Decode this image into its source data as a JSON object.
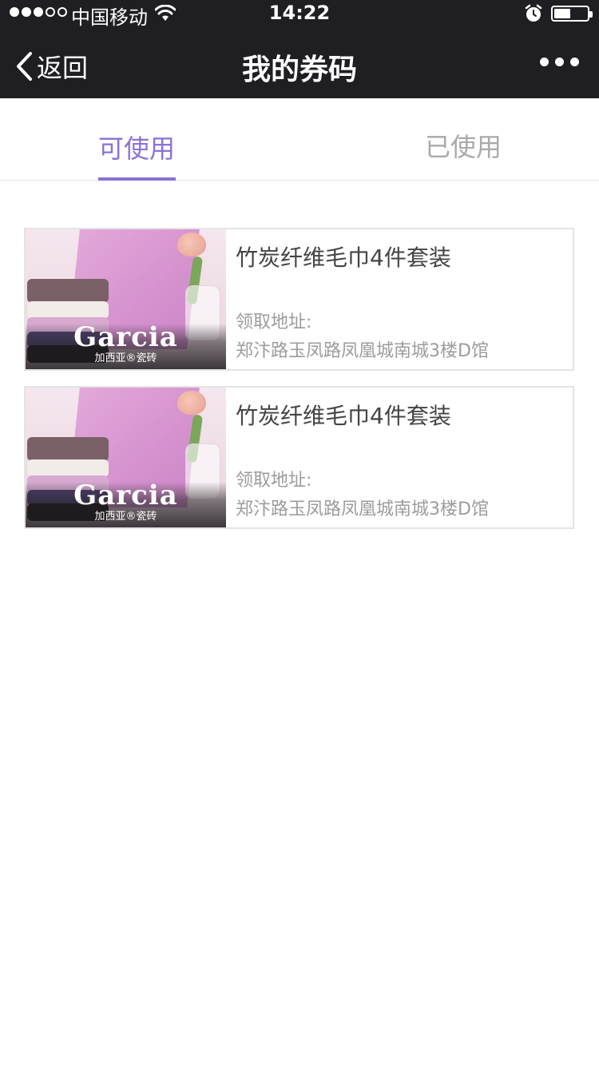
{
  "status_bar": {
    "signal_filled": 3,
    "signal_total": 5,
    "carrier": "中国移动",
    "time": "14:22",
    "battery_level": 0.5
  },
  "nav": {
    "back_label": "返回",
    "title": "我的券码"
  },
  "tabs": [
    {
      "label": "可使用",
      "active": true
    },
    {
      "label": "已使用",
      "active": false
    }
  ],
  "coupons": [
    {
      "title": "竹炭纤维毛巾4件套装",
      "address_label": "领取地址:",
      "address": "郑汴路玉凤路凤凰城南城3楼D馆",
      "image": {
        "brand": "Garcia",
        "brand_sub": "加西亚®瓷砖"
      }
    },
    {
      "title": "竹炭纤维毛巾4件套装",
      "address_label": "领取地址:",
      "address": "郑汴路玉凤路凤凰城南城3楼D馆",
      "image": {
        "brand": "Garcia",
        "brand_sub": "加西亚®瓷砖"
      }
    }
  ],
  "colors": {
    "accent": "#8b71d6",
    "topbar": "#1f1f23",
    "muted_text": "#9c9c9c"
  }
}
